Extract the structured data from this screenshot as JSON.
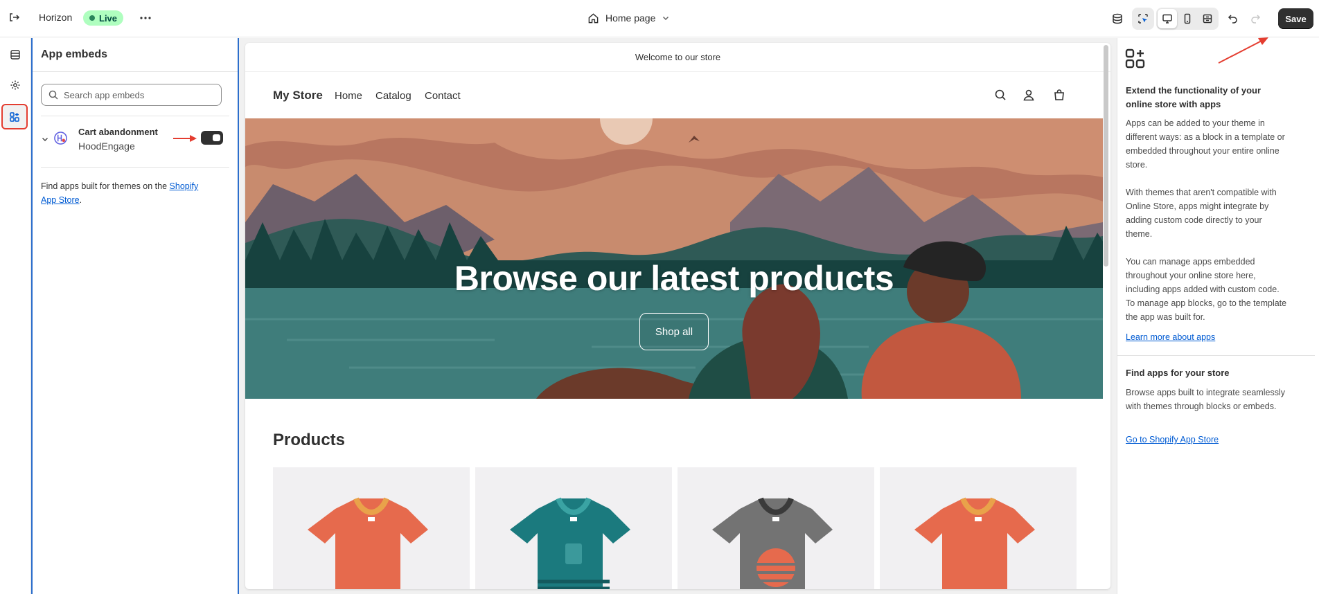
{
  "topbar": {
    "store_name": "Horizon",
    "live_badge": "Live",
    "page_selector": "Home page",
    "save_label": "Save"
  },
  "sidebar": {
    "title": "App embeds",
    "search_placeholder": "Search app embeds",
    "embed": {
      "title": "Cart abandonment",
      "app": "HoodEngage",
      "enabled": true
    },
    "footer_text": "Find apps built for themes on the ",
    "footer_link": "Shopify App Store",
    "footer_end": "."
  },
  "preview": {
    "announcement": "Welcome to our store",
    "store_name": "My Store",
    "nav": [
      "Home",
      "Catalog",
      "Contact"
    ],
    "hero_title": "Browse our latest products",
    "hero_button": "Shop all",
    "products_heading": "Products"
  },
  "right_panel": {
    "heading": "Extend the functionality of your online store with apps",
    "p1": "Apps can be added to your theme in different ways: as a block in a template or embedded throughout your entire online store.",
    "p2": "With themes that aren't compatible with Online Store, apps might integrate by adding custom code directly to your theme.",
    "p3": "You can manage apps embedded throughout your online store here, including apps added with custom code. To manage app blocks, go to the template the app was built for.",
    "learn_link": "Learn more about apps",
    "find_heading": "Find apps for your store",
    "find_text": "Browse apps built to integrate seamlessly with themes through blocks or embeds.",
    "find_link": "Go to Shopify App Store"
  },
  "colors": {
    "accent_red": "#e43d30",
    "live_badge_bg": "#affebf",
    "selection_blue": "#2c6ecb",
    "save_bg": "#303030"
  }
}
